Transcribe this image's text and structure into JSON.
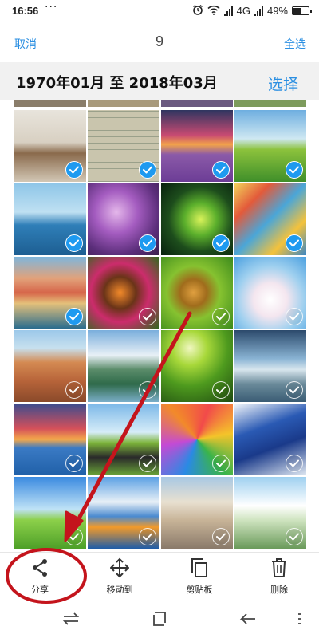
{
  "status_bar": {
    "time": "16:56",
    "dots": "···",
    "network": "4G",
    "battery": "49%",
    "icons": [
      "alarm-icon",
      "wifi-icon",
      "signal-icon",
      "signal-icon",
      "battery-icon"
    ]
  },
  "top_bar": {
    "cancel_label": "取消",
    "selected_count": "9",
    "select_all_label": "全选"
  },
  "date_header": {
    "range": "1970年01月 至 2018年03月",
    "select_label": "选择"
  },
  "photos": [
    {
      "scene": "interior",
      "selected": true
    },
    {
      "scene": "document",
      "selected": true
    },
    {
      "scene": "sunset-lavender",
      "selected": true
    },
    {
      "scene": "green-hills",
      "selected": true
    },
    {
      "scene": "sailboats",
      "selected": true
    },
    {
      "scene": "purple-flowers",
      "selected": true
    },
    {
      "scene": "green-spiral",
      "selected": true
    },
    {
      "scene": "birdhouses",
      "selected": true
    },
    {
      "scene": "coastal-town",
      "selected": true
    },
    {
      "scene": "butterfly-flowers",
      "selected": false
    },
    {
      "scene": "butterfly-leaf",
      "selected": false
    },
    {
      "scene": "blossoms",
      "selected": false
    },
    {
      "scene": "canyon",
      "selected": false
    },
    {
      "scene": "mountain-lake",
      "selected": false
    },
    {
      "scene": "grass-sun",
      "selected": false
    },
    {
      "scene": "mountain-clouds",
      "selected": false
    },
    {
      "scene": "sea-sunset",
      "selected": false
    },
    {
      "scene": "road",
      "selected": false
    },
    {
      "scene": "umbrellas",
      "selected": false
    },
    {
      "scene": "blue-sails",
      "selected": false
    },
    {
      "scene": "meadow",
      "selected": false
    },
    {
      "scene": "kayak-lake",
      "selected": false
    },
    {
      "scene": "city-square",
      "selected": false
    },
    {
      "scene": "runner",
      "selected": false
    }
  ],
  "toolbar": {
    "share": {
      "label": "分享",
      "icon": "share-icon"
    },
    "move": {
      "label": "移动到",
      "icon": "move-icon"
    },
    "clipboard": {
      "label": "剪贴板",
      "icon": "clipboard-icon"
    },
    "delete": {
      "label": "删除",
      "icon": "trash-icon"
    }
  },
  "navigation_bar": {
    "icons": [
      "switch-icon",
      "square-icon",
      "back-icon",
      "menu-icon"
    ]
  },
  "annotation": {
    "color": "#c4141c"
  },
  "colors": {
    "accent": "#2b8fe2",
    "check_selected": "#1e9af0"
  }
}
